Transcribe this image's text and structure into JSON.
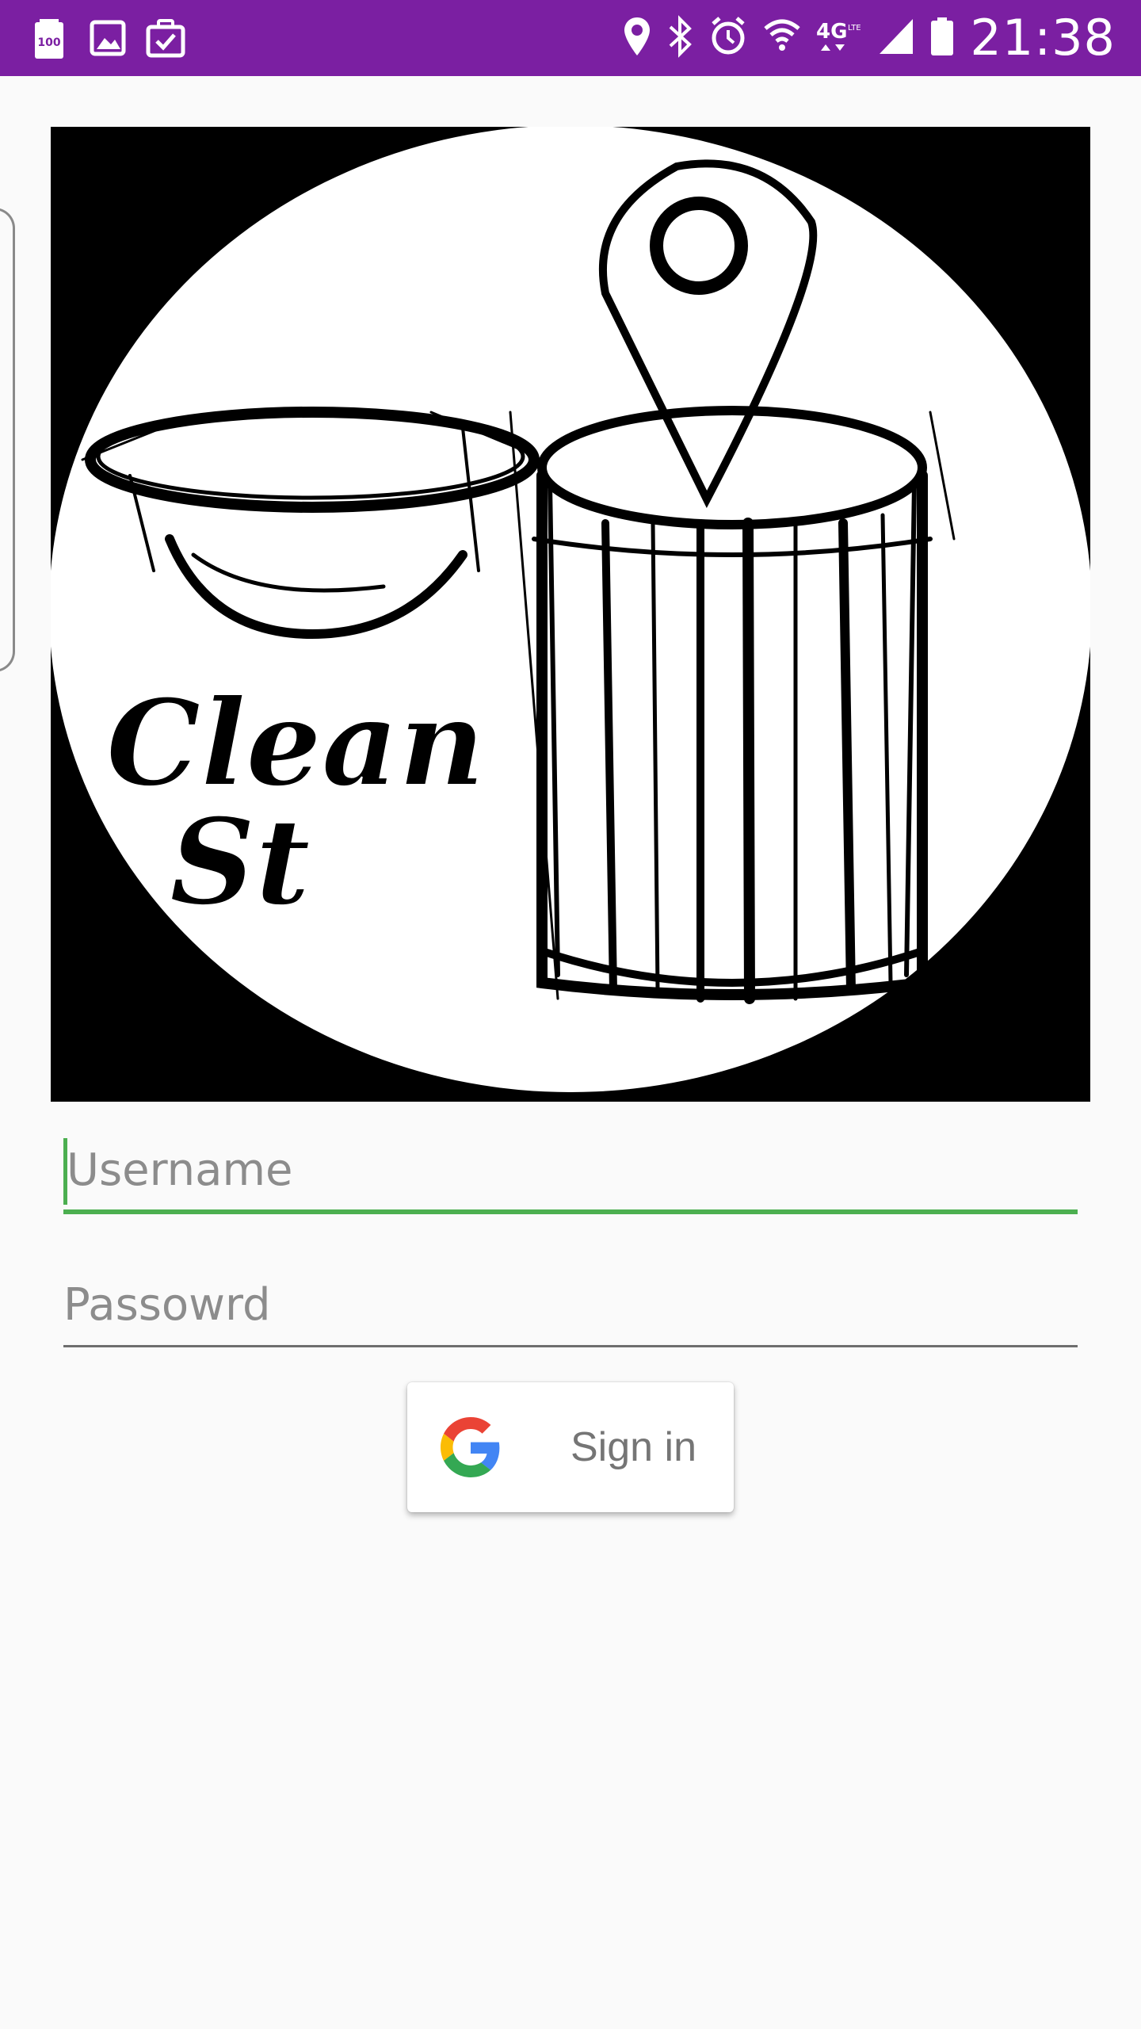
{
  "status_bar": {
    "background": "#7b1fa2",
    "left_icons": [
      "battery-100-icon",
      "image-icon",
      "work-bag-icon"
    ],
    "right_icons": [
      "location-pin-icon",
      "bluetooth-icon",
      "alarm-icon",
      "wifi-icon",
      "4g-lte-icon",
      "signal-icon",
      "battery-icon"
    ],
    "time": "21:38"
  },
  "logo": {
    "text_line1": "Clean",
    "text_line2": "St",
    "background": "#000000"
  },
  "form": {
    "username": {
      "placeholder": "Username",
      "value": "",
      "accent": "#4caf50"
    },
    "password": {
      "placeholder": "Passowrd",
      "value": ""
    }
  },
  "signin": {
    "label": "Sign in",
    "icon": "google-g-icon"
  }
}
